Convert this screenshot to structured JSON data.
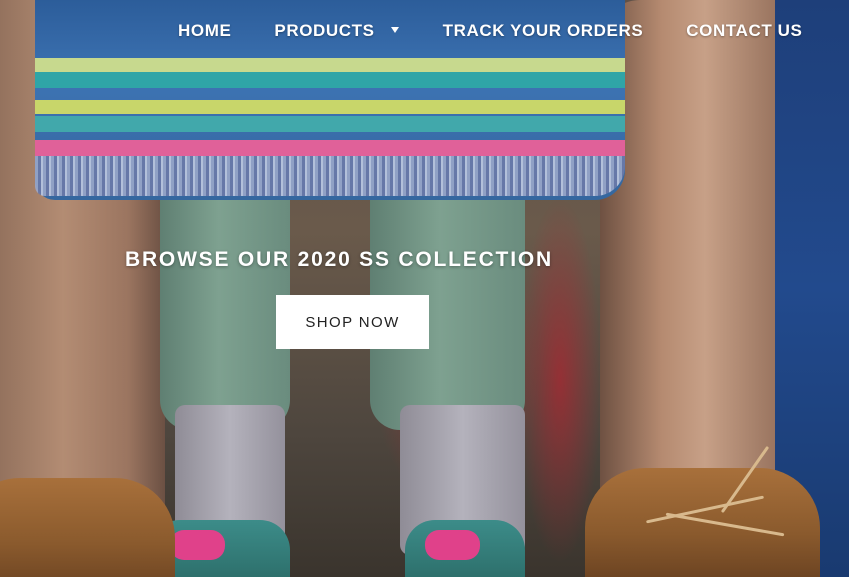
{
  "nav": {
    "items": [
      {
        "label": "HOME"
      },
      {
        "label": "PRODUCTS",
        "has_dropdown": true,
        "icon": "caret-down-icon"
      },
      {
        "label": "TRACK YOUR ORDERS"
      },
      {
        "label": "CONTACT US"
      }
    ]
  },
  "hero": {
    "headline": "BROWSE OUR 2020 SS COLLECTION",
    "cta_label": "SHOP NOW"
  },
  "colors": {
    "nav_text": "#ffffff",
    "button_bg": "#ffffff",
    "button_text": "#222222"
  }
}
